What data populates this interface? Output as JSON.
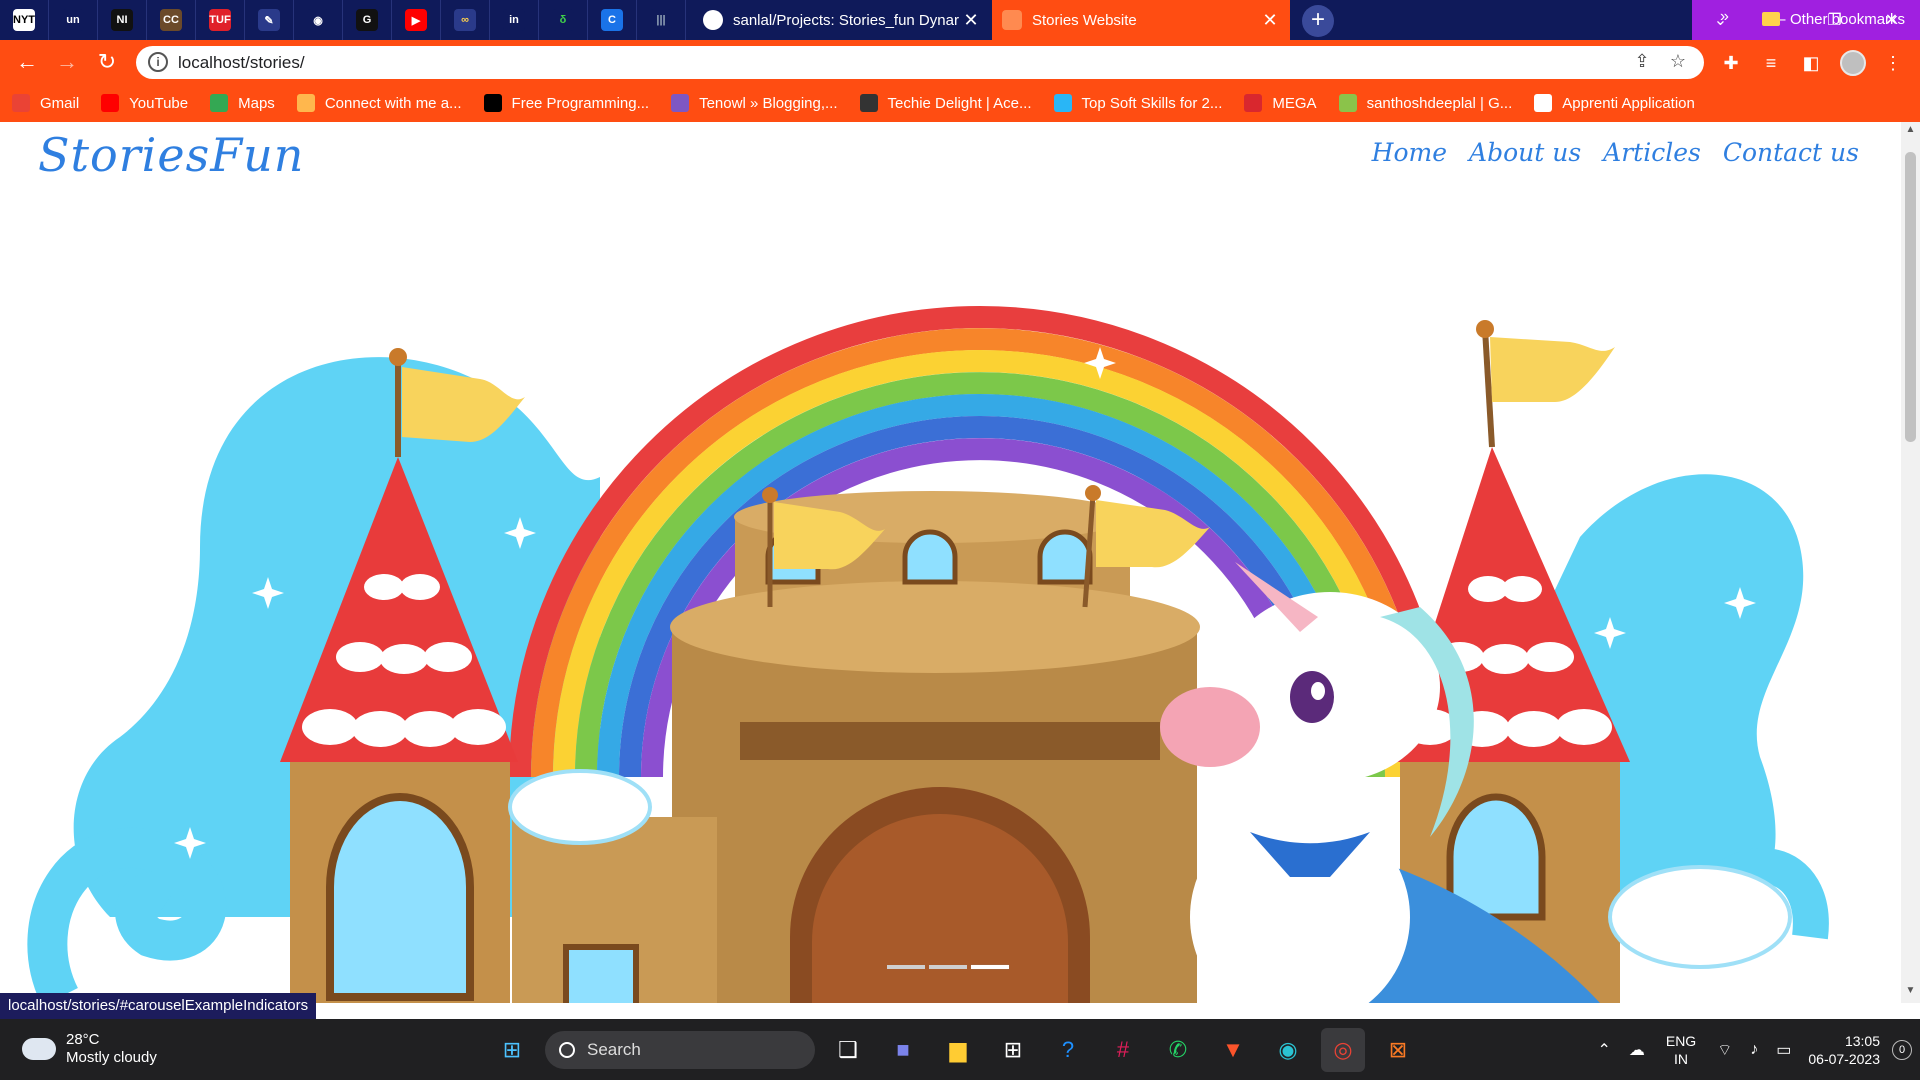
{
  "browser": {
    "pinned_tabs": [
      {
        "icon": "nyt-icon",
        "glyph": "NYT",
        "color": "#ffffff",
        "fg": "#000000"
      },
      {
        "icon": "unacademy-icon",
        "glyph": "un",
        "color": "#0f1a5a",
        "fg": "#ffffff"
      },
      {
        "icon": "ni-icon",
        "glyph": "NI",
        "color": "#111111",
        "fg": "#ffffff"
      },
      {
        "icon": "cc-icon",
        "glyph": "CC",
        "color": "#6b4a2a",
        "fg": "#ffffff"
      },
      {
        "icon": "tuf-icon",
        "glyph": "TUF",
        "color": "#e0202a",
        "fg": "#ffffff"
      },
      {
        "icon": "feather-icon",
        "glyph": "✎",
        "color": "#2a3a8a",
        "fg": "#ffffff"
      },
      {
        "icon": "github-icon",
        "glyph": "◉",
        "color": "#0f1a5a",
        "fg": "#ffffff"
      },
      {
        "icon": "g-icon",
        "glyph": "G",
        "color": "#111111",
        "fg": "#ffffff"
      },
      {
        "icon": "youtube-icon",
        "glyph": "▶",
        "color": "#ff0000",
        "fg": "#ffffff"
      },
      {
        "icon": "glasses-icon",
        "glyph": "∞",
        "color": "#2a3a8a",
        "fg": "#ffd24d"
      },
      {
        "icon": "linkedin-icon",
        "glyph": "in",
        "color": "#0f1a5a",
        "fg": "#ffffff"
      },
      {
        "icon": "leaf-icon",
        "glyph": "δ",
        "color": "#0f1a5a",
        "fg": "#3fcf4a"
      },
      {
        "icon": "c-icon",
        "glyph": "C",
        "color": "#1a73e8",
        "fg": "#ffffff"
      },
      {
        "icon": "cisco-icon",
        "glyph": "|||",
        "color": "#0f1a5a",
        "fg": "#9ab"
      }
    ],
    "tabs": [
      {
        "label": "sanlal/Projects: Stories_fun Dynar",
        "active": false,
        "favicon_color": "#ffffff"
      },
      {
        "label": "Stories Website",
        "active": true,
        "favicon_color": "#ff8a50"
      }
    ],
    "address": "localhost/stories/",
    "bookmarks": [
      {
        "label": "Gmail",
        "color": "#ea4335"
      },
      {
        "label": "YouTube",
        "color": "#ff0000"
      },
      {
        "label": "Maps",
        "color": "#34a853"
      },
      {
        "label": "Connect with me a...",
        "color": "#ffb74d"
      },
      {
        "label": "Free Programming...",
        "color": "#000000"
      },
      {
        "label": "Tenowl » Blogging,...",
        "color": "#7e57c2"
      },
      {
        "label": "Techie Delight | Ace...",
        "color": "#333333"
      },
      {
        "label": "Top Soft Skills for 2...",
        "color": "#29b6f6"
      },
      {
        "label": "MEGA",
        "color": "#d9272e"
      },
      {
        "label": "santhoshdeeplal | G...",
        "color": "#8bc34a"
      },
      {
        "label": "Apprenti Application",
        "color": "#ffffff"
      }
    ],
    "bookmarks_more": "»",
    "other_bookmarks": "Other bookmarks",
    "status_url": "localhost/stories/#carouselExampleIndicators"
  },
  "site": {
    "brand": "StoriesFun",
    "nav": [
      "Home",
      "About us",
      "Articles",
      "Contact us"
    ],
    "carousel": {
      "slides": 3,
      "active_index": 2
    },
    "accent": "#2f7fe0"
  },
  "taskbar": {
    "weather_temp": "28°C",
    "weather_desc": "Mostly cloudy",
    "search_placeholder": "Search",
    "lang_top": "ENG",
    "lang_bottom": "IN",
    "time": "13:05",
    "date": "06-07-2023",
    "notifications": "0"
  }
}
